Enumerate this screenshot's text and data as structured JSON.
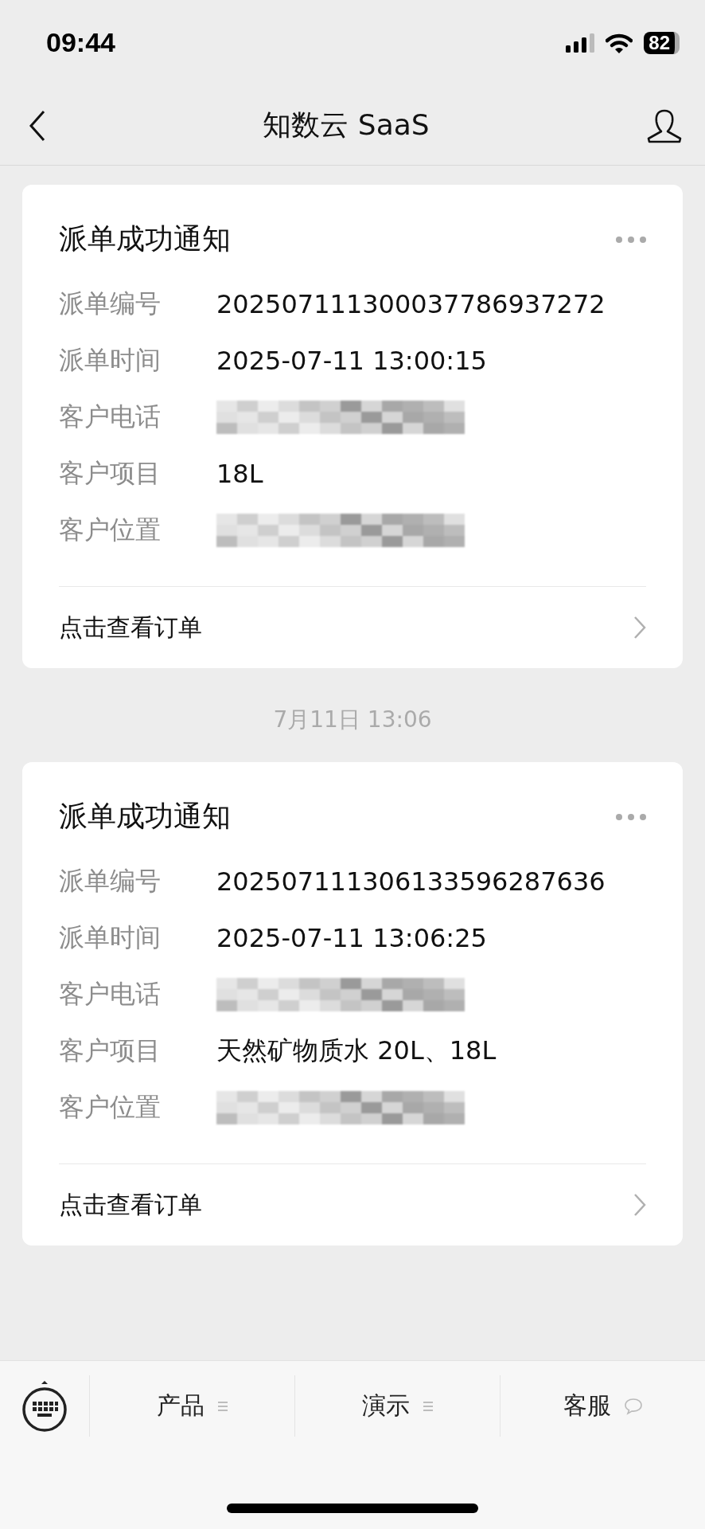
{
  "status_bar": {
    "time": "09:44",
    "battery": "82"
  },
  "header": {
    "title": "知数云 SaaS"
  },
  "messages": [
    {
      "title": "派单成功通知",
      "fields": [
        {
          "label": "派单编号",
          "kind": "text",
          "value": "202507111300037786937272"
        },
        {
          "label": "派单时间",
          "kind": "text",
          "value": "2025-07-11 13:00:15"
        },
        {
          "label": "客户电话",
          "kind": "blurred"
        },
        {
          "label": "客户项目",
          "kind": "text",
          "value": "18L"
        },
        {
          "label": "客户位置",
          "kind": "blurred"
        }
      ],
      "link": "点击查看订单"
    },
    {
      "timestamp": "7月11日 13:06",
      "title": "派单成功通知",
      "fields": [
        {
          "label": "派单编号",
          "kind": "text",
          "value": "202507111306133596287636"
        },
        {
          "label": "派单时间",
          "kind": "text",
          "value": "2025-07-11 13:06:25"
        },
        {
          "label": "客户电话",
          "kind": "blurred"
        },
        {
          "label": "客户项目",
          "kind": "text",
          "value": "天然矿物质水 20L、18L"
        },
        {
          "label": "客户位置",
          "kind": "blurred"
        }
      ],
      "link": "点击查看订单"
    }
  ],
  "menu": [
    {
      "label": "产品",
      "kind": "list"
    },
    {
      "label": "演示",
      "kind": "list"
    },
    {
      "label": "客服",
      "kind": "chat"
    }
  ]
}
